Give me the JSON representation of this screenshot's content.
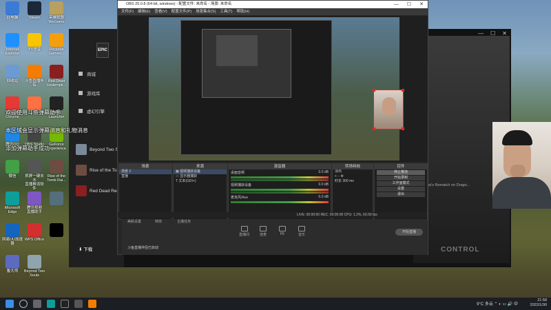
{
  "desktop": {
    "icons": [
      {
        "label": "此电脑",
        "color": "#3a7bd5"
      },
      {
        "label": "Steam",
        "color": "#1b2838"
      },
      {
        "label": "英雄联盟\nWeGame",
        "color": "#b8a060"
      },
      {
        "label": "Internet\nExplorer",
        "color": "#1e90ff"
      },
      {
        "label": "YY语音",
        "color": "#f7c600"
      },
      {
        "label": "Rockstar\nGames...",
        "color": "#f59e0b"
      },
      {
        "label": "回收站",
        "color": "#6b9bd2"
      },
      {
        "label": "斗鱼直播伴侣",
        "color": "#f57c00"
      },
      {
        "label": "Red Dead\nRedempti...",
        "color": "#8b1e1e"
      },
      {
        "label": "Google\nChrome",
        "color": "#e53935"
      },
      {
        "label": "",
        "color": "#ff7043"
      },
      {
        "label": "EPIC\nLauncher",
        "color": "#222222"
      },
      {
        "label": "腾讯QQ",
        "color": "#1e88e5"
      },
      {
        "label": "OBS Studio",
        "color": "#444444"
      },
      {
        "label": "GeForce\nExperience",
        "color": "#76b900"
      },
      {
        "label": "微信",
        "color": "#43a047"
      },
      {
        "label": "抓屏一键去水\n直播推流软件",
        "color": "#555555"
      },
      {
        "label": "Rise of the\nTomb Rai...",
        "color": "#6d4c41"
      },
      {
        "label": "Microsoft\nEdge",
        "color": "#0f9d9a"
      },
      {
        "label": "腾讯视频\n直播助手",
        "color": "#7e57c2"
      },
      {
        "label": "",
        "color": "#546e7a"
      },
      {
        "label": "网易UU加速\n器",
        "color": "#1565c0"
      },
      {
        "label": "WPS Office",
        "color": "#d32f2f"
      },
      {
        "label": "",
        "color": "#000000"
      },
      {
        "label": "鲁大师",
        "color": "#5c6bc0"
      },
      {
        "label": "Beyond Two\nSouls",
        "color": "#90a4ae"
      }
    ]
  },
  "danmaku": [
    "欢迎使用斗鱼弹幕助手",
    "本区域会显示弹幕消息和礼物消息",
    "添加弹幕助手成功"
  ],
  "epic": {
    "logo": "EPIC",
    "nav": [
      "商城",
      "游戏库",
      "虚幻引擎"
    ],
    "games": [
      "Beyond Two Souls",
      "Rise of the Tomb...",
      "Red Dead Redempt..."
    ],
    "download": "下载",
    "card_text": "Dine Dina's Rematch on Drago...",
    "control_logo": "CONTROL"
  },
  "obs": {
    "title": "OBS 25.0.8 (64-bit, windows) - 配置文件: 未命名 - 场景: 未命名",
    "menu": [
      "文件(F)",
      "编辑(E)",
      "查看(V)",
      "配置文件(P)",
      "场景集合(S)",
      "工具(T)",
      "帮助(H)"
    ],
    "docks": {
      "scenes": {
        "header": "场景",
        "items": [
          "场景 2",
          "直播"
        ]
      },
      "sources": {
        "header": "来源",
        "items": [
          "视频捕获设备",
          "显示器捕获",
          "文本(GDI+)"
        ]
      },
      "mixer": {
        "header": "混音器",
        "tracks": [
          {
            "name": "桌面音频",
            "db": "0.0 dB"
          },
          {
            "name": "视频捕获设备",
            "db": "0.0 dB"
          },
          {
            "name": "麦克风/Aux",
            "db": "0.0 dB"
          }
        ]
      },
      "transitions": {
        "header": "转场特效",
        "type": "淡出",
        "duration_label": "时长",
        "duration": "300 ms"
      },
      "controls": {
        "header": "控件",
        "buttons": [
          "停止推流",
          "开始录制",
          "工作室模式",
          "设置",
          "退出"
        ]
      }
    },
    "status": "LIVE: 00:00:00   REC: 00:00:00   CPU: 1.2%, 60.00 fps"
  },
  "douyu": {
    "items": [
      "美颜设置",
      "特效",
      "主播任务",
      "直播间",
      "连麦",
      "PK",
      "音乐"
    ],
    "start_button": "开始直播",
    "warning": "斗鱼直播伴侣已启动"
  },
  "taskbar": {
    "time": "21:58",
    "date": "2022/1/30",
    "weather": "9°C 多云",
    "lang": "中"
  }
}
